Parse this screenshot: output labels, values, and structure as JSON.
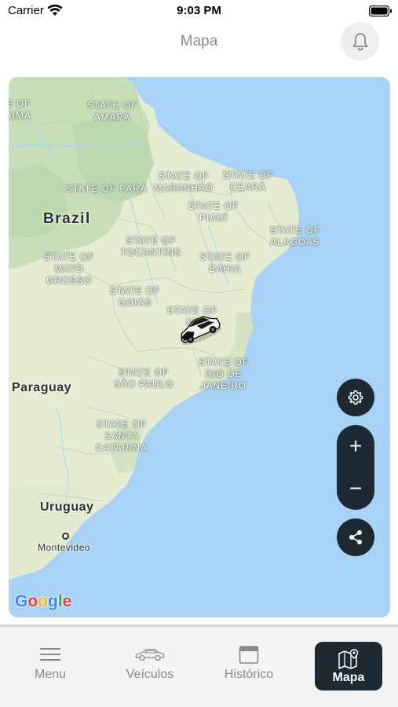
{
  "status_bar": {
    "carrier": "Carrier",
    "time": "9:03 PM"
  },
  "header": {
    "title": "Mapa",
    "notification_icon": "bell-icon"
  },
  "map": {
    "provider": "Google",
    "country_labels": [
      "Brazil",
      "Paraguay",
      "Uruguay"
    ],
    "city_labels": [
      "Montevideo"
    ],
    "state_labels": {
      "amapa": "STATE OF\nAMAPÁ",
      "para": "STATE OF PARÁ",
      "maranhao": "STATE OF\nMARANHÃO",
      "ceara": "STATE OF\nCEARÁ",
      "piaui": "STATE OF\nPIAUÍ",
      "alagoas": "STATE OF\nALAGOAS",
      "tocantins": "STATE OF\nTOCANTINS",
      "bahia": "STATE OF\nBAHIA",
      "mato_grosso": "STATE OF\nMATO\nGROSSO",
      "goias": "STATE OF\nGOIÁS",
      "minas": "STATE OF\nMI\nG",
      "rio": "STATE OF\nRIO DE\nJANEIRO",
      "sao_paulo": "STATE OF\nSÃO PAULO",
      "santa_catarina": "STATE OF\nSANTA\nCATARINA",
      "roraima_partial": "E OF\nAIMA"
    },
    "controls": {
      "settings_icon": "gear-icon",
      "zoom_in": "+",
      "zoom_out": "−",
      "share_icon": "share-icon"
    },
    "marker_icon": "car-icon"
  },
  "tab_bar": {
    "items": [
      {
        "label": "Menu",
        "icon": "hamburger-icon",
        "active": false
      },
      {
        "label": "Veículos",
        "icon": "car-icon",
        "active": false
      },
      {
        "label": "Histórico",
        "icon": "calendar-icon",
        "active": false
      },
      {
        "label": "Mapa",
        "icon": "map-icon",
        "active": true
      }
    ]
  },
  "colors": {
    "accent_dark": "#1e2a33",
    "ocean": "#a9d3f6",
    "land": "#e6ecd2",
    "forest": "#c6dfb8"
  }
}
